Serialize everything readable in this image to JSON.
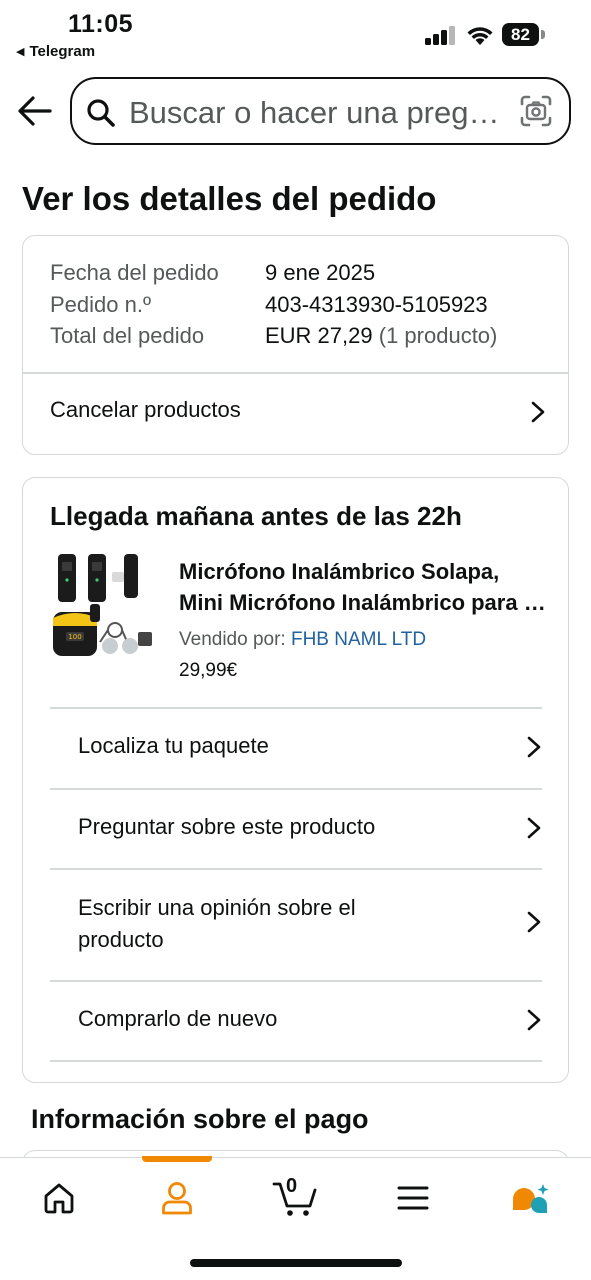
{
  "status_bar": {
    "time": "11:05",
    "back_app": "Telegram",
    "battery": "82"
  },
  "search": {
    "placeholder": "Buscar o hacer una pregunta"
  },
  "page": {
    "title": "Ver los detalles del pedido"
  },
  "order_summary": {
    "rows": [
      {
        "label": "Fecha del pedido",
        "value": "9 ene 2025"
      },
      {
        "label": "Pedido n.º",
        "value": "403-4313930-5105923"
      },
      {
        "label": "Total del pedido",
        "value": "EUR 27,29",
        "extra": "(1 producto)"
      }
    ],
    "cancel_label": "Cancelar productos"
  },
  "shipment": {
    "delivery_title": "Llegada mañana antes de las 22h",
    "product": {
      "title_line1": "Micrófono Inalámbrico Solapa,",
      "title_line2": "Mini Micrófono Inalámbrico para iPhone",
      "sold_by_label": "Vendido por:",
      "seller": "FHB NAML LTD",
      "price": "29,99€"
    },
    "actions": [
      "Localiza tu paquete",
      "Preguntar sobre este producto",
      "Escribir una opinión sobre el producto",
      "Comprarlo de nuevo"
    ]
  },
  "payment": {
    "title": "Información sobre el pago"
  },
  "bottom_nav": {
    "cart_count": "0",
    "active": "profile",
    "active_color": "#f08804",
    "items": [
      "home-icon",
      "profile-icon",
      "cart-icon",
      "menu-icon",
      "rufus-icon"
    ]
  },
  "colors": {
    "seller_link": "#2162a1",
    "divider": "#d5d9d9",
    "accent": "#f08804",
    "rufus_teal": "#1ea1b5"
  }
}
